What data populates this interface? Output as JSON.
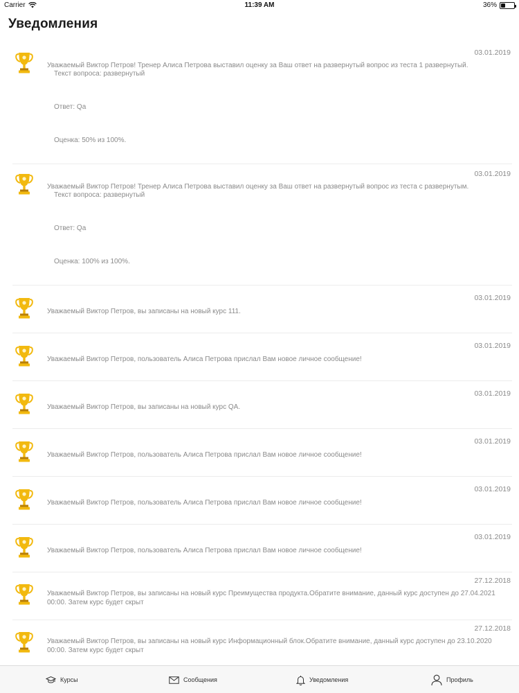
{
  "status_bar": {
    "carrier": "Carrier",
    "time": "11:39 AM",
    "battery": "36%",
    "battery_level": 0.36
  },
  "header": {
    "title": "Уведомления"
  },
  "notifications": [
    {
      "date": "03.01.2019",
      "text": "Уважаемый Виктор Петров! Тренер Алиса Петрова выставил оценку за Ваш ответ на развернутый вопрос из теста 1 развернутый.",
      "question": "Текст вопроса: развернутый",
      "answer": "Ответ: Qa",
      "grade": "Оценка: 50% из 100%."
    },
    {
      "date": "03.01.2019",
      "text": "Уважаемый Виктор Петров! Тренер Алиса Петрова выставил оценку за Ваш ответ на развернутый вопрос из теста с развернутым.",
      "question": "Текст вопроса: развернутый",
      "answer": "Ответ: Qa",
      "grade": "Оценка: 100% из 100%."
    },
    {
      "date": "03.01.2019",
      "text": "Уважаемый Виктор Петров, вы записаны на новый курс 111."
    },
    {
      "date": "03.01.2019",
      "text": "Уважаемый Виктор Петров, пользователь Алиса Петрова прислал Вам новое личное сообщение!"
    },
    {
      "date": "03.01.2019",
      "text": "Уважаемый Виктор Петров, вы записаны на новый курс QA."
    },
    {
      "date": "03.01.2019",
      "text": "Уважаемый Виктор Петров, пользователь Алиса Петрова прислал Вам новое личное сообщение!"
    },
    {
      "date": "03.01.2019",
      "text": "Уважаемый Виктор Петров, пользователь Алиса Петрова прислал Вам новое личное сообщение!"
    },
    {
      "date": "03.01.2019",
      "text": "Уважаемый Виктор Петров, пользователь Алиса Петрова прислал Вам новое личное сообщение!"
    },
    {
      "date": "27.12.2018",
      "text": "Уважаемый Виктор Петров, вы записаны на новый курс Преимущества продукта.Обратите внимание, данный курс доступен до 27.04.2021 00:00. Затем курс будет скрыт"
    },
    {
      "date": "27.12.2018",
      "text": "Уважаемый Виктор Петров, вы записаны на новый курс Информационный блок.Обратите внимание, данный курс доступен до 23.10.2020 00:00. Затем курс будет скрыт"
    }
  ],
  "tabbar": {
    "courses": "Курсы",
    "messages": "Сообщения",
    "notifications": "Уведомления",
    "profile": "Профиль"
  },
  "icons": {
    "item": "trophy-icon",
    "courses": "graduation-cap-icon",
    "messages": "envelope-icon",
    "notifications": "bell-icon",
    "profile": "user-icon"
  },
  "colors": {
    "trophy": "#f2b90f",
    "trophy_dark": "#b87f08",
    "text": "#8a8a8a",
    "title": "#1c1c1c"
  }
}
